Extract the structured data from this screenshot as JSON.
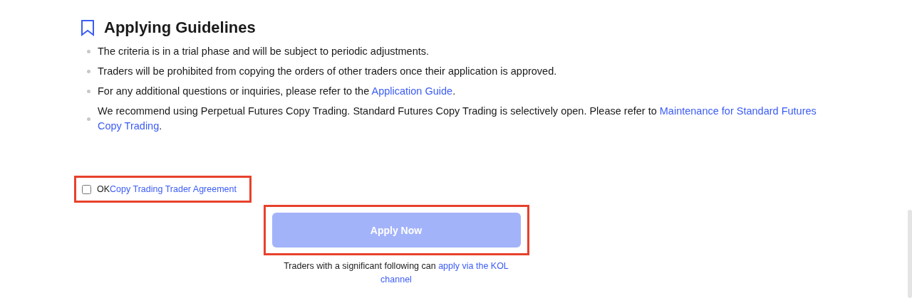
{
  "section": {
    "title": "Applying Guidelines"
  },
  "guidelines": [
    {
      "text": "The criteria is in a trial phase and will be subject to periodic adjustments."
    },
    {
      "text": "Traders will be prohibited from copying the orders of other traders once their application is approved."
    },
    {
      "text": "For any additional questions or inquiries, please refer to the ",
      "link": "Application Guide",
      "after": "."
    },
    {
      "text": "We recommend using Perpetual Futures Copy Trading. Standard Futures Copy Trading is selectively open. Please refer to ",
      "link_lines": [
        "Maintenance for Standard Futures",
        "Copy Trading"
      ],
      "after": "."
    }
  ],
  "agreement": {
    "checked": false,
    "highlighted": true,
    "label": "OK",
    "link": "Copy Trading Trader Agreement"
  },
  "apply_button": {
    "label": "Apply Now",
    "disabled": true,
    "highlighted": true
  },
  "footer": {
    "text": "Traders with a significant following can ",
    "link_lines": [
      "apply via the KOL",
      "channel"
    ]
  }
}
